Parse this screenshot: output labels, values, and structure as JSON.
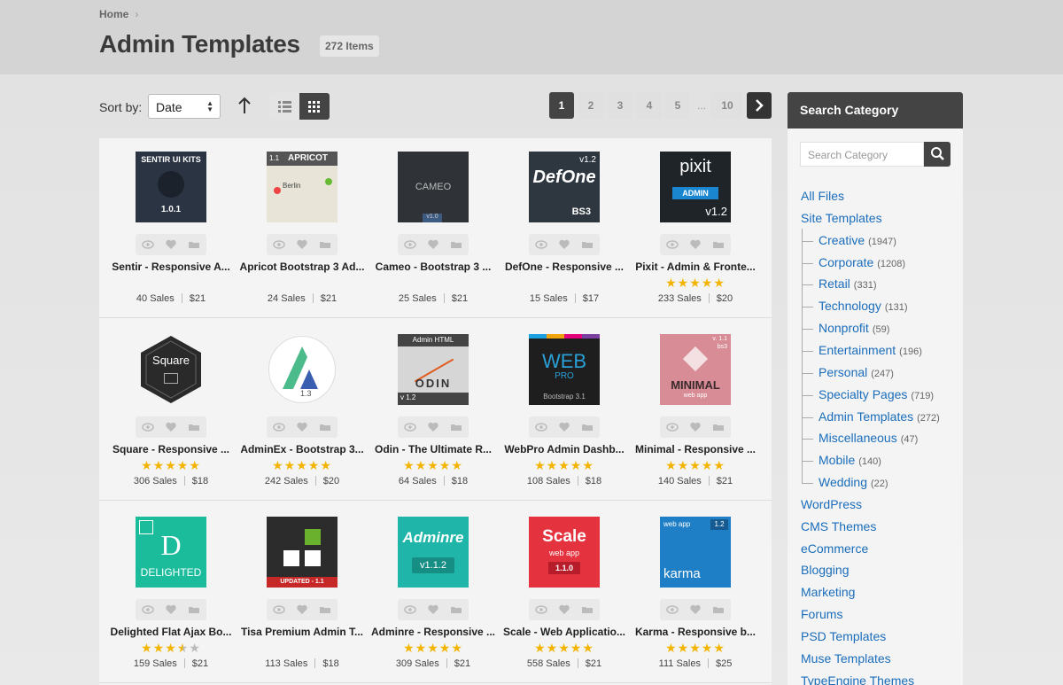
{
  "breadcrumb": {
    "home": "Home",
    "separator": ">"
  },
  "page": {
    "title": "Admin Templates",
    "item_count": "272 Items"
  },
  "toolbar": {
    "sort_label": "Sort by:",
    "sort_value": "Date",
    "pages": [
      "1",
      "2",
      "3",
      "4",
      "5",
      "...",
      "10"
    ],
    "active_page": "1",
    "next_icon": "chevron-right-icon"
  },
  "items": [
    {
      "title": "Sentir - Responsive A...",
      "sales": "40 Sales",
      "price": "$21",
      "rating": 0
    },
    {
      "title": "Apricot Bootstrap 3 Ad...",
      "sales": "24 Sales",
      "price": "$21",
      "rating": 0
    },
    {
      "title": "Cameo - Bootstrap 3 ...",
      "sales": "25 Sales",
      "price": "$21",
      "rating": 0
    },
    {
      "title": "DefOne - Responsive ...",
      "sales": "15 Sales",
      "price": "$17",
      "rating": 0
    },
    {
      "title": "Pixit - Admin & Fronte...",
      "sales": "233 Sales",
      "price": "$20",
      "rating": 5
    },
    {
      "title": "Square - Responsive ...",
      "sales": "306 Sales",
      "price": "$18",
      "rating": 5
    },
    {
      "title": "AdminEx - Bootstrap 3...",
      "sales": "242 Sales",
      "price": "$20",
      "rating": 5
    },
    {
      "title": "Odin - The Ultimate R...",
      "sales": "64 Sales",
      "price": "$18",
      "rating": 5
    },
    {
      "title": "WebPro Admin Dashb...",
      "sales": "108 Sales",
      "price": "$18",
      "rating": 5
    },
    {
      "title": "Minimal - Responsive ...",
      "sales": "140 Sales",
      "price": "$21",
      "rating": 5
    },
    {
      "title": "Delighted Flat Ajax Bo...",
      "sales": "159 Sales",
      "price": "$21",
      "rating": 3.5
    },
    {
      "title": "Tisa Premium Admin T...",
      "sales": "113 Sales",
      "price": "$18",
      "rating": 0
    },
    {
      "title": "Adminre - Responsive ...",
      "sales": "309 Sales",
      "price": "$21",
      "rating": 5
    },
    {
      "title": "Scale - Web Applicatio...",
      "sales": "558 Sales",
      "price": "$21",
      "rating": 5
    },
    {
      "title": "Karma - Responsive b...",
      "sales": "111 Sales",
      "price": "$25",
      "rating": 5
    }
  ],
  "thumbs": {
    "sentir": {
      "line1": "SENTIR UI KITS",
      "line2": "1.0.1"
    },
    "apricot": {
      "version": "1.1",
      "name": "APRICOT",
      "city": "Berlin"
    },
    "cameo": {
      "name": "CAMEO",
      "version": "v1.0"
    },
    "defone": {
      "version": "v1.2",
      "name": "DefOne",
      "tag": "BS3"
    },
    "pixit": {
      "name": "pixit",
      "tag": "ADMIN",
      "version": "v1.2"
    },
    "square": {
      "name": "Square"
    },
    "adminex": {
      "version": "1.3"
    },
    "odin": {
      "top": "Admin HTML",
      "name": "ODIN",
      "version": "v 1.2"
    },
    "webpro": {
      "name": "WEB",
      "sub": "PRO",
      "tag": "Bootstrap 3.1"
    },
    "minimal": {
      "version": "v. 1.1",
      "tag": "bs3",
      "name": "MINIMAL",
      "sub": "web app"
    },
    "delighted": {
      "letter": "D",
      "name": "DELIGHTED"
    },
    "tisa": {
      "tag": "UPDATED - 1.1"
    },
    "adminre": {
      "name": "Adminre",
      "version": "v1.1.2"
    },
    "scale": {
      "name": "Scale",
      "sub": "web app",
      "version": "1.1.0"
    },
    "karma": {
      "tag": "web app",
      "version": "1.2",
      "name": "karma"
    }
  },
  "sidebar": {
    "title": "Search Category",
    "search_placeholder": "Search Category",
    "categories": [
      {
        "label": "All Files",
        "count": ""
      },
      {
        "label": "Site Templates",
        "count": ""
      },
      {
        "label": "Creative",
        "count": "(1947)"
      },
      {
        "label": "Corporate",
        "count": "(1208)"
      },
      {
        "label": "Retail",
        "count": "(331)"
      },
      {
        "label": "Technology",
        "count": "(131)"
      },
      {
        "label": "Nonprofit",
        "count": "(59)"
      },
      {
        "label": "Entertainment",
        "count": "(196)"
      },
      {
        "label": "Personal",
        "count": "(247)"
      },
      {
        "label": "Specialty Pages",
        "count": "(719)"
      },
      {
        "label": "Admin Templates",
        "count": "(272)"
      },
      {
        "label": "Miscellaneous",
        "count": "(47)"
      },
      {
        "label": "Mobile",
        "count": "(140)"
      },
      {
        "label": "Wedding",
        "count": "(22)"
      },
      {
        "label": "WordPress",
        "count": ""
      },
      {
        "label": "CMS Themes",
        "count": ""
      },
      {
        "label": "eCommerce",
        "count": ""
      },
      {
        "label": "Blogging",
        "count": ""
      },
      {
        "label": "Marketing",
        "count": ""
      },
      {
        "label": "Forums",
        "count": ""
      },
      {
        "label": "PSD Templates",
        "count": ""
      },
      {
        "label": "Muse Templates",
        "count": ""
      },
      {
        "label": "TypeEngine Themes",
        "count": ""
      }
    ]
  }
}
